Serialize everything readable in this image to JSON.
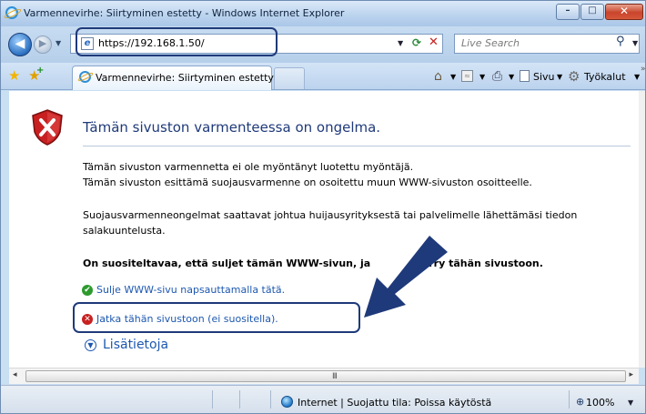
{
  "window": {
    "title": "Varmennevirhe: Siirtyminen estetty - Windows Internet Explorer",
    "controls": {
      "minimize": "–",
      "maximize": "□",
      "close": "✕"
    }
  },
  "address_bar": {
    "url": "https://192.168.1.50/",
    "back_glyph": "◀",
    "forward_glyph": "▶",
    "page_icon_glyph": "e",
    "refresh_glyph": "⟳",
    "stop_glyph": "✕",
    "search_placeholder": "Live Search",
    "search_glyph": "⚲"
  },
  "tabs": [
    {
      "label": "Varmennevirhe: Siirtyminen estetty",
      "active": true
    }
  ],
  "toolbar": {
    "home_glyph": "⌂",
    "feeds_glyph": "≈",
    "print_glyph": "⎙",
    "page_label": "Sivu",
    "tools_label": "Työkalut",
    "tools_glyph": "⚙",
    "dropdown_glyph": "▼",
    "chevron_glyph": "»"
  },
  "content": {
    "heading": "Tämän sivuston varmenteessa on ongelma.",
    "paragraph1_line1": "Tämän sivuston varmennetta ei ole myöntänyt luotettu myöntäjä.",
    "paragraph1_line2": "Tämän sivuston esittämä suojausvarmenne on osoitettu muun WWW-sivuston osoitteelle.",
    "paragraph2_line1": "Suojausvarmenneongelmat saattavat johtua huijausyrityksestä tai palvelimelle lähettämäsi tiedon",
    "paragraph2_line2": "salakuuntelusta.",
    "recommendation": "On suositeltavaa, että suljet tämän WWW-sivun, ja",
    "recommendation_tail": "rry tähän sivustoon.",
    "link_close": "Sulje WWW-sivu napsauttamalla tätä.",
    "link_continue": "Jatka tähän sivustoon (ei suositella).",
    "more_info": "Lisätietoja",
    "ok_glyph": "✔",
    "bad_glyph": "✕",
    "more_glyph": "▼"
  },
  "scrollbar": {
    "left_glyph": "◂",
    "right_glyph": "▸",
    "grip": "III"
  },
  "status_bar": {
    "zone_text": "Internet | Suojattu tila: Poissa käytöstä",
    "zoom": "100%",
    "zoom_glyph": "⊕"
  },
  "colors": {
    "heading": "#1f3a7a",
    "link": "#1d58b0",
    "annotation": "#1f3a7a",
    "shield_red": "#c82020"
  }
}
